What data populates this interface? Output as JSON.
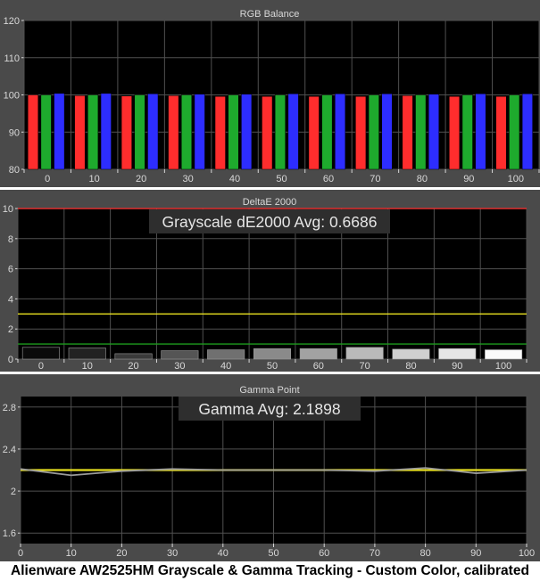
{
  "caption": "Alienware AW2525HM Grayscale & Gamma Tracking - Custom Color, calibrated",
  "colors": {
    "panel_bg": "#000000",
    "frame_bg": "#4a4a4a",
    "gridline": "#505050",
    "text": "#d8d8d8",
    "red": "#ff2d2d",
    "green": "#1eaa2d",
    "blue": "#2d2dff",
    "limit_red": "#e03030",
    "limit_yellow": "#e8e020",
    "limit_green": "#1c9a1c",
    "gamma_target": "#e8e020",
    "gamma_measured": "#9a9a9a"
  },
  "chart_data": [
    {
      "type": "bar",
      "title": "RGB Balance",
      "categories": [
        "0",
        "10",
        "20",
        "30",
        "40",
        "50",
        "60",
        "70",
        "80",
        "90",
        "100"
      ],
      "series": [
        {
          "color": "red",
          "values": [
            100.0,
            99.8,
            99.7,
            99.8,
            99.6,
            99.6,
            99.6,
            99.6,
            99.8,
            99.6,
            99.6
          ]
        },
        {
          "color": "green",
          "values": [
            100.0,
            100.0,
            100.0,
            100.0,
            100.0,
            100.0,
            100.0,
            100.0,
            100.0,
            100.0,
            100.0
          ]
        },
        {
          "color": "blue",
          "values": [
            100.4,
            100.4,
            100.3,
            100.2,
            100.2,
            100.3,
            100.3,
            100.3,
            100.2,
            100.3,
            100.3
          ]
        }
      ],
      "ylim": [
        80,
        120
      ],
      "yticks": [
        "80",
        "90",
        "100",
        "110",
        "120"
      ],
      "grid": true
    },
    {
      "type": "bar",
      "title": "DeltaE 2000",
      "annotation": "Grayscale dE2000 Avg: 0.6686",
      "categories": [
        "0",
        "10",
        "20",
        "30",
        "40",
        "50",
        "60",
        "70",
        "80",
        "90",
        "100"
      ],
      "values": [
        0.78,
        0.74,
        0.36,
        0.56,
        0.62,
        0.7,
        0.7,
        0.78,
        0.66,
        0.7,
        0.62
      ],
      "bar_shades": [
        "#0a0a0a",
        "#222222",
        "#3a3a3a",
        "#555555",
        "#707070",
        "#8a8a8a",
        "#a2a2a2",
        "#bababa",
        "#d0d0d0",
        "#e6e6e6",
        "#fafafa"
      ],
      "ylim": [
        0,
        10
      ],
      "yticks": [
        "0",
        "2",
        "4",
        "6",
        "8",
        "10"
      ],
      "reference_lines": [
        {
          "value": 10,
          "color": "limit_red"
        },
        {
          "value": 3,
          "color": "limit_yellow"
        },
        {
          "value": 1,
          "color": "limit_green"
        }
      ],
      "grid": true
    },
    {
      "type": "line",
      "title": "Gamma Point",
      "annotation": "Gamma Avg: 2.1898",
      "x": [
        0,
        10,
        20,
        30,
        40,
        50,
        60,
        70,
        80,
        90,
        100
      ],
      "series": [
        {
          "color": "gamma_target",
          "values": [
            2.2,
            2.2,
            2.2,
            2.2,
            2.2,
            2.2,
            2.2,
            2.2,
            2.2,
            2.2,
            2.2
          ]
        },
        {
          "color": "gamma_measured",
          "values": [
            2.21,
            2.15,
            2.19,
            2.21,
            2.2,
            2.2,
            2.2,
            2.19,
            2.22,
            2.17,
            2.2
          ]
        }
      ],
      "xlim": [
        0,
        100
      ],
      "xticks": [
        "0",
        "10",
        "20",
        "30",
        "40",
        "50",
        "60",
        "70",
        "80",
        "90",
        "100"
      ],
      "ylim": [
        1.5,
        2.9
      ],
      "yticks": [
        "1.6",
        "2",
        "2.4",
        "2.8"
      ],
      "grid": true
    }
  ]
}
